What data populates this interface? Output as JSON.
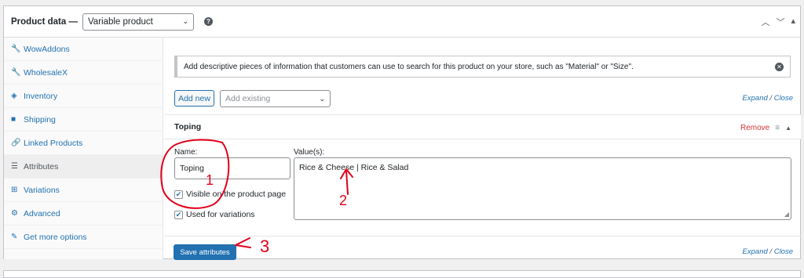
{
  "header": {
    "title": "Product data —",
    "product_type": "Variable product",
    "help": "?",
    "controls": [
      "▲",
      "▼",
      "▲"
    ]
  },
  "sidebar": {
    "items": [
      {
        "label": "WowAddons",
        "icon": "wrench-icon",
        "glyph": "🔧",
        "active": false
      },
      {
        "label": "WholesaleX",
        "icon": "wrench-icon",
        "glyph": "🔧",
        "active": false
      },
      {
        "label": "Inventory",
        "icon": "tag-icon",
        "glyph": "◈",
        "active": false
      },
      {
        "label": "Shipping",
        "icon": "truck-icon",
        "glyph": "■",
        "active": false
      },
      {
        "label": "Linked Products",
        "icon": "link-icon",
        "glyph": "🔗",
        "active": false
      },
      {
        "label": "Attributes",
        "icon": "list-icon",
        "glyph": "☰",
        "active": true
      },
      {
        "label": "Variations",
        "icon": "grid-icon",
        "glyph": "⊞",
        "active": false
      },
      {
        "label": "Advanced",
        "icon": "gear-icon",
        "glyph": "⚙",
        "active": false
      },
      {
        "label": "Get more options",
        "icon": "plugin-icon",
        "glyph": "✎",
        "active": false
      }
    ]
  },
  "main": {
    "notice": "Add descriptive pieces of information that customers can use to search for this product on your store, such as \"Material\" or \"Size\".",
    "add_new": "Add new",
    "add_existing_placeholder": "Add existing",
    "expand": "Expand",
    "close": "Close",
    "attribute": {
      "name_title": "Toping",
      "remove": "Remove",
      "name_label": "Name:",
      "name_value": "Toping",
      "values_label": "Value(s):",
      "values_value": "Rice & Cheese | Rice & Salad",
      "visible_label": "Visible on the product page",
      "visible_checked": true,
      "variations_label": "Used for variations",
      "variations_checked": true
    },
    "save": "Save attributes"
  },
  "annotations": [
    "1",
    "2",
    "3"
  ],
  "colors": {
    "accent": "#2271b1",
    "remove": "#d63638",
    "annotation": "#e0001a"
  }
}
